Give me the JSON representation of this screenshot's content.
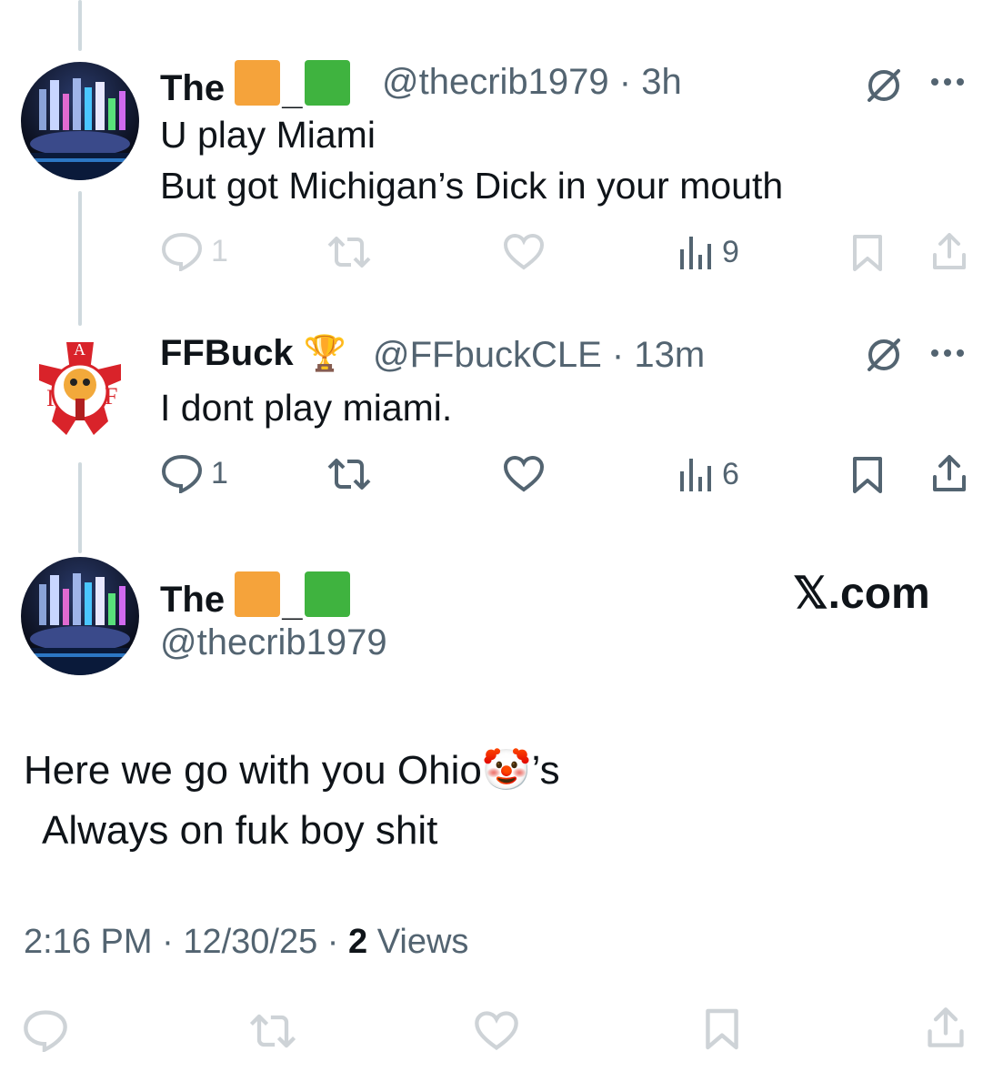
{
  "tweets": [
    {
      "name": "The",
      "handle": "@thecrib1979",
      "separator": "·",
      "time": "3h",
      "lines": [
        "U play Miami",
        "But got Michigan’s Dick in your mouth"
      ],
      "replies": "1",
      "views": "9",
      "faded": true
    },
    {
      "name": "FFBuck",
      "badge_emoji": "🏆",
      "handle": "@FFbuckCLE",
      "separator": "·",
      "time": "13m",
      "lines": [
        "I dont play miami."
      ],
      "replies": "1",
      "views": "6",
      "faded": false
    }
  ],
  "main_tweet": {
    "name": "The",
    "handle": "@thecrib1979",
    "watermark": "𝕏.com",
    "line1": "Here we go with you Ohio",
    "clown_emoji": "🤡",
    "line1_suffix": "’s",
    "line2": "Always on fuk boy shit",
    "timestamp_time": "2:16 PM",
    "timestamp_date": "12/30/25",
    "dot": "·",
    "views_count": "2",
    "views_label": "Views"
  },
  "icons": {
    "reply": "reply-icon",
    "retweet": "retweet-icon",
    "like": "like-icon",
    "views": "views-icon",
    "bookmark": "bookmark-icon",
    "share": "share-icon",
    "grok": "grok-icon",
    "more": "more-icon"
  },
  "colors": {
    "orange_square": "#f5a33b",
    "green_square": "#3fb33f",
    "gray": "#536471",
    "thread_line": "#cfd9de"
  }
}
